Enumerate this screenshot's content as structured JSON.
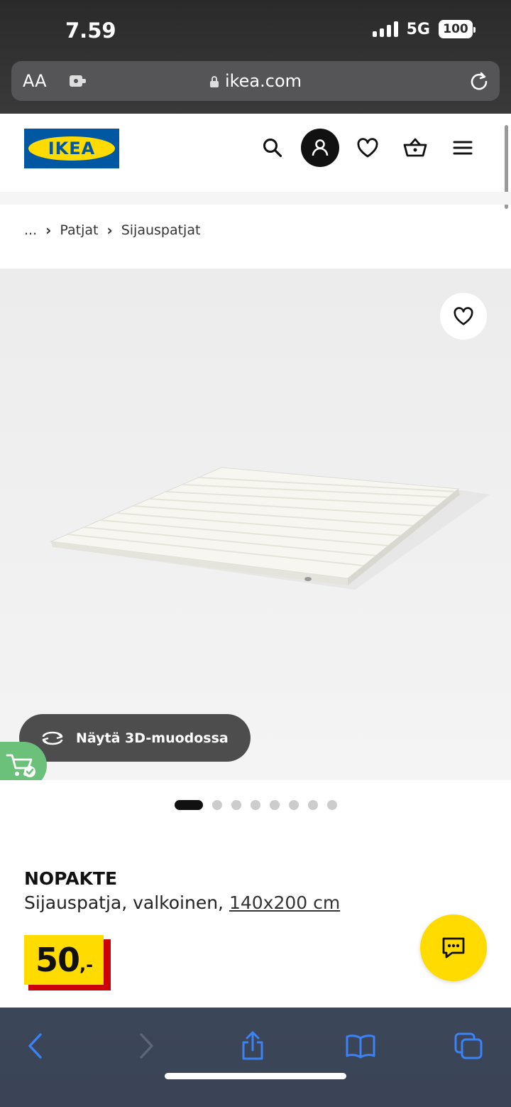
{
  "status_bar": {
    "time": "7.59",
    "network": "5G",
    "battery": "100"
  },
  "browser": {
    "text_size_label": "AA",
    "url": "ikea.com"
  },
  "header": {
    "logo_text": "IKEA"
  },
  "breadcrumb": {
    "ellipsis": "...",
    "items": [
      "Patjat",
      "Sijauspatjat"
    ]
  },
  "product_image": {
    "view_3d_label": "Näytä 3D-muodossa",
    "carousel": {
      "count": 8,
      "active": 0
    }
  },
  "product": {
    "name": "NOPAKTE",
    "description": "Sijauspatja, valkoinen, ",
    "size": "140x200 cm",
    "price_int": "50",
    "price_dec": ",-"
  },
  "colors": {
    "ikea_blue": "#0058a3",
    "ikea_yellow": "#ffdb00",
    "price_red": "#cc0008",
    "ios_blue": "#3b82f6"
  }
}
